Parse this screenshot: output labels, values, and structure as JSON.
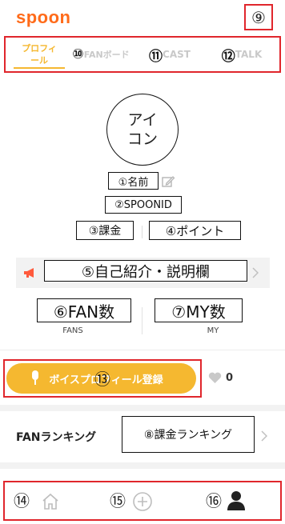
{
  "header": {
    "logo": "spoon",
    "settings_marker": "⑨"
  },
  "tabs": [
    {
      "label": "プロフィール",
      "marker": "",
      "active": true
    },
    {
      "label": "FANボード",
      "marker": "⑩"
    },
    {
      "label": "CAST",
      "marker": "⑪"
    },
    {
      "label": "TALK",
      "marker": "⑫"
    }
  ],
  "profile": {
    "avatar_text": "アイコン",
    "name_box": "①名前",
    "spoon_id_box": "②SPOONID",
    "billing_box": "③課金",
    "points_box": "④ポイント"
  },
  "bio": {
    "text": "⑤自己紹介・説明欄"
  },
  "stats": {
    "fan_box": "⑥FAN数",
    "fan_label": "FANS",
    "my_box": "⑦MY数",
    "my_label": "MY"
  },
  "voice": {
    "button_label": "ボイスプロフィール登録",
    "marker": "⑬",
    "like_count": "0"
  },
  "ranking": {
    "title": "FANランキング",
    "box": "⑧課金ランキング"
  },
  "bottom_nav": {
    "home_marker": "⑭",
    "add_marker": "⑮",
    "profile_marker": "⑯"
  },
  "colors": {
    "brand": "#ff6b1a",
    "accent": "#f5b830",
    "annotation": "#e0262c"
  }
}
